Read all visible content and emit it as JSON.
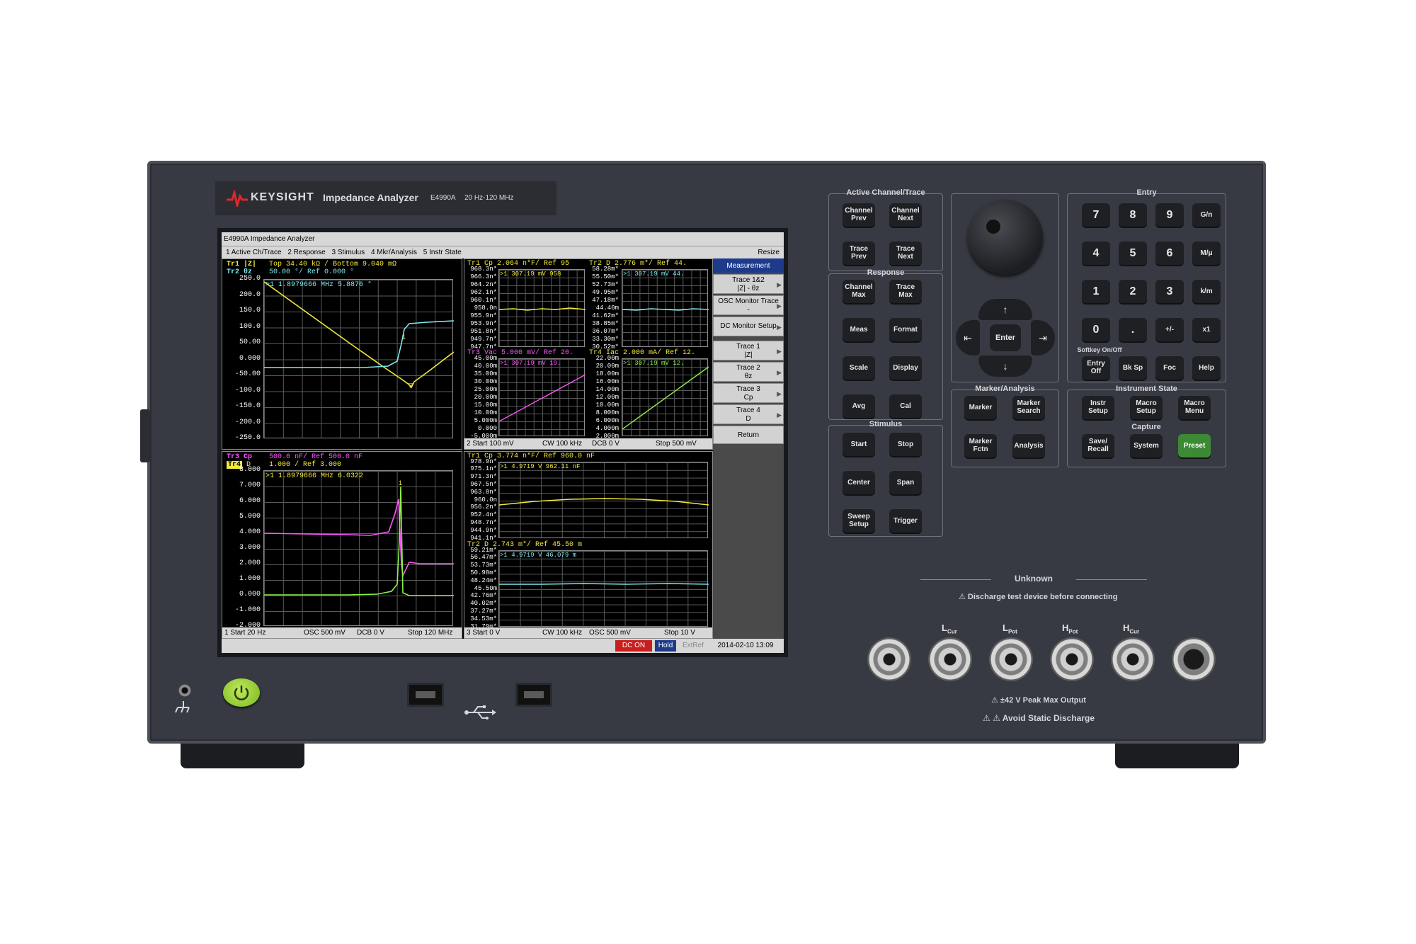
{
  "brand": {
    "name": "KEYSIGHT",
    "product": "Impedance Analyzer",
    "model": "E4990A",
    "range": "20 Hz-120 MHz"
  },
  "screen": {
    "window_title": "E4990A Impedance Analyzer",
    "menu": [
      "1 Active Ch/Trace",
      "2 Response",
      "3 Stimulus",
      "4 Mkr/Analysis",
      "5 Instr State"
    ],
    "resize": "Resize",
    "ch1": {
      "tr1_label": "Tr1 |Z|",
      "tr1_scale": "Top 34.40 kΩ / Bottom 9.040 mΩ",
      "tr2_label": "Tr2 θz",
      "tr2_scale": "50.00 °/ Ref 0.000 °",
      "marker": ">1  1.8979666 MHz  5.8876 °",
      "yticks": [
        "250.0",
        "200.0",
        "150.0",
        "100.0",
        "50.00",
        "0.000",
        "-50.00",
        "-100.0",
        "-150.0",
        "-200.0",
        "-250.0"
      ]
    },
    "ch1b": {
      "tr3_label": "Tr3 Cp",
      "tr3_scale": "500.0 nF/ Ref 500.0 nF",
      "tr4_label": "Tr4",
      "tr4_sub": "D",
      "tr4_scale": "1.000 / Ref 3.000",
      "marker": ">1  1.8979666 MHz  6.0322",
      "yticks": [
        "8.000",
        "7.000",
        "6.000",
        "5.000",
        "4.000",
        "3.000",
        "2.000",
        "1.000",
        "0.000",
        "-1.000",
        "-2.000"
      ],
      "status": {
        "start": "1  Start 20 Hz",
        "osc": "OSC 500 mV",
        "dcb": "DCB 0 V",
        "stop": "Stop 120 MHz"
      }
    },
    "ch2": {
      "tr1_header": "Tr1 Cp   2.064 n*F/ Ref 95",
      "tr1_marker": ">1  307.19 mV  958",
      "tr1_ticks": [
        "968.3n*",
        "966.3n*",
        "964.2n*",
        "962.1n*",
        "960.1n*",
        "958.0n",
        "955.9n*",
        "953.9n*",
        "951.8n*",
        "949.7n*",
        "947.7n*"
      ],
      "tr2_header": "Tr2 D    2.776 m*/ Ref 44.",
      "tr2_marker": ">1  307.19 mV  44.",
      "tr2_ticks": [
        "58.28m*",
        "55.50m*",
        "52.73m*",
        "49.95m*",
        "47.18m*",
        "44.40m",
        "41.62m*",
        "38.85m*",
        "36.07m*",
        "33.30m*",
        "30.52m*"
      ],
      "tr3_header": "Tr3 Vac  5.000 mV/ Ref 20.",
      "tr3_marker": ">1  307.19 mV  19.",
      "tr3_ticks": [
        "45.00m",
        "40.00m",
        "35.00m",
        "30.00m",
        "25.00m",
        "20.00m",
        "15.00m",
        "10.00m",
        "5.000m",
        "0.000",
        "-5.000m"
      ],
      "tr4_header": "Tr4 Iac  2.000 mA/ Ref 12.",
      "tr4_marker": ">1  307.19 mV  12.",
      "tr4_ticks": [
        "22.00m",
        "20.00m",
        "18.00m",
        "16.00m",
        "14.00m",
        "12.00m",
        "10.00m",
        "8.000m",
        "6.000m",
        "4.000m",
        "2.000m"
      ],
      "status": {
        "start": "2  Start 100 mV",
        "cw": "CW 100 kHz",
        "dcb": "DCB 0 V",
        "stop": "Stop 500 mV"
      }
    },
    "ch3": {
      "tr1_header": "Tr1 Cp   3.774 n*F/ Ref 960.0 nF",
      "tr1_marker": ">1  4.9719 V  962.11 nF",
      "tr1_ticks": [
        "978.9n*",
        "975.1n*",
        "971.3n*",
        "967.5n*",
        "963.8n*",
        "960.0n",
        "956.2n*",
        "952.4n*",
        "948.7n*",
        "944.9n*",
        "941.1n*"
      ],
      "tr2_header": "Tr2 D    2.743 m*/ Ref 45.50 m",
      "tr2_marker": ">1  4.9719 V  46.079 m",
      "tr2_ticks": [
        "59.21m*",
        "56.47m*",
        "53.73m*",
        "50.98m*",
        "48.24m*",
        "45.50m",
        "42.76m*",
        "40.02m*",
        "37.27m*",
        "34.53m*",
        "31.79m*"
      ],
      "status": {
        "start": "3  Start 0 V",
        "cw": "CW 100 kHz",
        "osc": "OSC 500 mV",
        "stop": "Stop 10 V"
      }
    },
    "softkeys": {
      "title": "Measurement",
      "items": [
        {
          "l1": "Trace 1&2",
          "l2": "|Z| - θz"
        },
        {
          "l1": "OSC Monitor Trace",
          "l2": "-"
        },
        {
          "l1": "DC Monitor Setup",
          "l2": ""
        },
        {
          "l1": "Trace 1",
          "l2": "|Z|"
        },
        {
          "l1": "Trace 2",
          "l2": "θz"
        },
        {
          "l1": "Trace 3",
          "l2": "Cp"
        },
        {
          "l1": "Trace 4",
          "l2": "D"
        },
        {
          "l1": "Return",
          "l2": ""
        }
      ]
    },
    "bottom": {
      "dc_on": "DC ON",
      "hold": "Hold",
      "extref": "ExtRef",
      "datetime": "2014-02-10 13:09"
    }
  },
  "panels": {
    "active": {
      "title": "Active Channel/Trace",
      "keys": [
        "Channel Prev",
        "Channel Next",
        "Trace Prev",
        "Trace Next"
      ]
    },
    "response": {
      "title": "Response",
      "keys": [
        "Channel Max",
        "Trace Max",
        "Meas",
        "Format",
        "Scale",
        "Display",
        "Avg",
        "Cal"
      ]
    },
    "stimulus": {
      "title": "Stimulus",
      "keys": [
        "Start",
        "Stop",
        "Center",
        "Span",
        "Sweep Setup",
        "Trigger"
      ]
    },
    "nav": {
      "enter": "Enter"
    },
    "marker": {
      "title": "Marker/Analysis",
      "keys": [
        "Marker",
        "Marker Search",
        "Marker Fctn",
        "Analysis"
      ]
    },
    "entry": {
      "title": "Entry",
      "keys": [
        "7",
        "8",
        "9",
        "G/n",
        "4",
        "5",
        "6",
        "M/μ",
        "1",
        "2",
        "3",
        "k/m",
        "0",
        ".",
        "+/-",
        "x1"
      ],
      "softkey_label": "Softkey On/Off",
      "bottom_keys": [
        "Entry Off",
        "Bk Sp",
        "Foc",
        "Help"
      ]
    },
    "instr": {
      "title": "Instrument State",
      "keys": [
        "Instr Setup",
        "Macro Setup",
        "Macro Menu"
      ],
      "capture_title": "Capture",
      "capture_keys": [
        "Save/ Recall",
        "System",
        "Preset"
      ]
    }
  },
  "front": {
    "unknown": "Unknown",
    "discharge": "⚠ Discharge test device before connecting",
    "connectors": [
      "L",
      "L",
      "H",
      "H"
    ],
    "conn_subs": [
      "Cur",
      "Pot",
      "Pot",
      "Cur"
    ],
    "peak": "⚠ ±42 V Peak Max Output",
    "static": "⚠ ⚠ Avoid Static Discharge"
  },
  "icons": [
    "power-icon",
    "usb-icon",
    "ground-icon",
    "keysight-logo-icon"
  ],
  "colors": {
    "trace_yellow": "#f2ea3c",
    "trace_cyan": "#7fe8ef",
    "trace_magenta": "#ff57ff",
    "trace_green": "#8cf04c",
    "preset_green": "#3d8a35",
    "power_green": "#8fd12e"
  }
}
